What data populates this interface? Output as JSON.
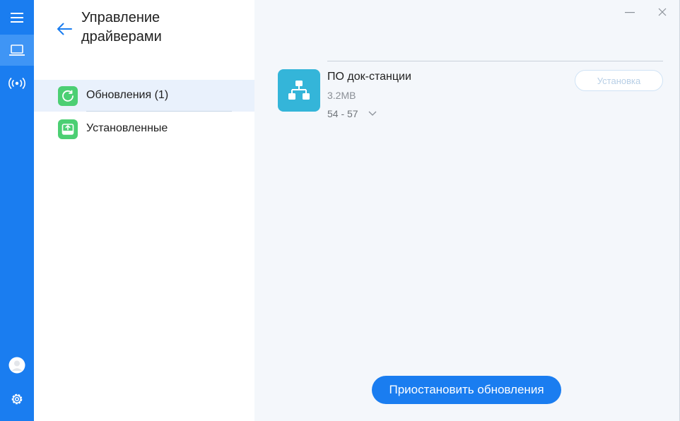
{
  "rail": {
    "items": [
      {
        "icon": "menu-icon"
      },
      {
        "icon": "laptop-icon",
        "active": true
      },
      {
        "icon": "broadcast-icon"
      },
      {
        "icon": "avatar"
      },
      {
        "icon": "gear-icon"
      }
    ]
  },
  "sidebar": {
    "title": "Управление драйверами",
    "items": [
      {
        "label": "Обновления (1)",
        "icon": "refresh-icon",
        "active": true
      },
      {
        "label": "Установленные",
        "icon": "installed-icon",
        "active": false
      }
    ]
  },
  "main": {
    "driver": {
      "name": "ПО док-станции",
      "size": "3.2MB",
      "version": "54 - 57",
      "install_label": "Установка"
    },
    "pause_label": "Приостановить обновления"
  },
  "colors": {
    "accent": "#1a7df0",
    "rail_active": "#3f95f5",
    "nav_icon_green": "#4ccf73",
    "app_icon_teal": "#34b5d9"
  }
}
